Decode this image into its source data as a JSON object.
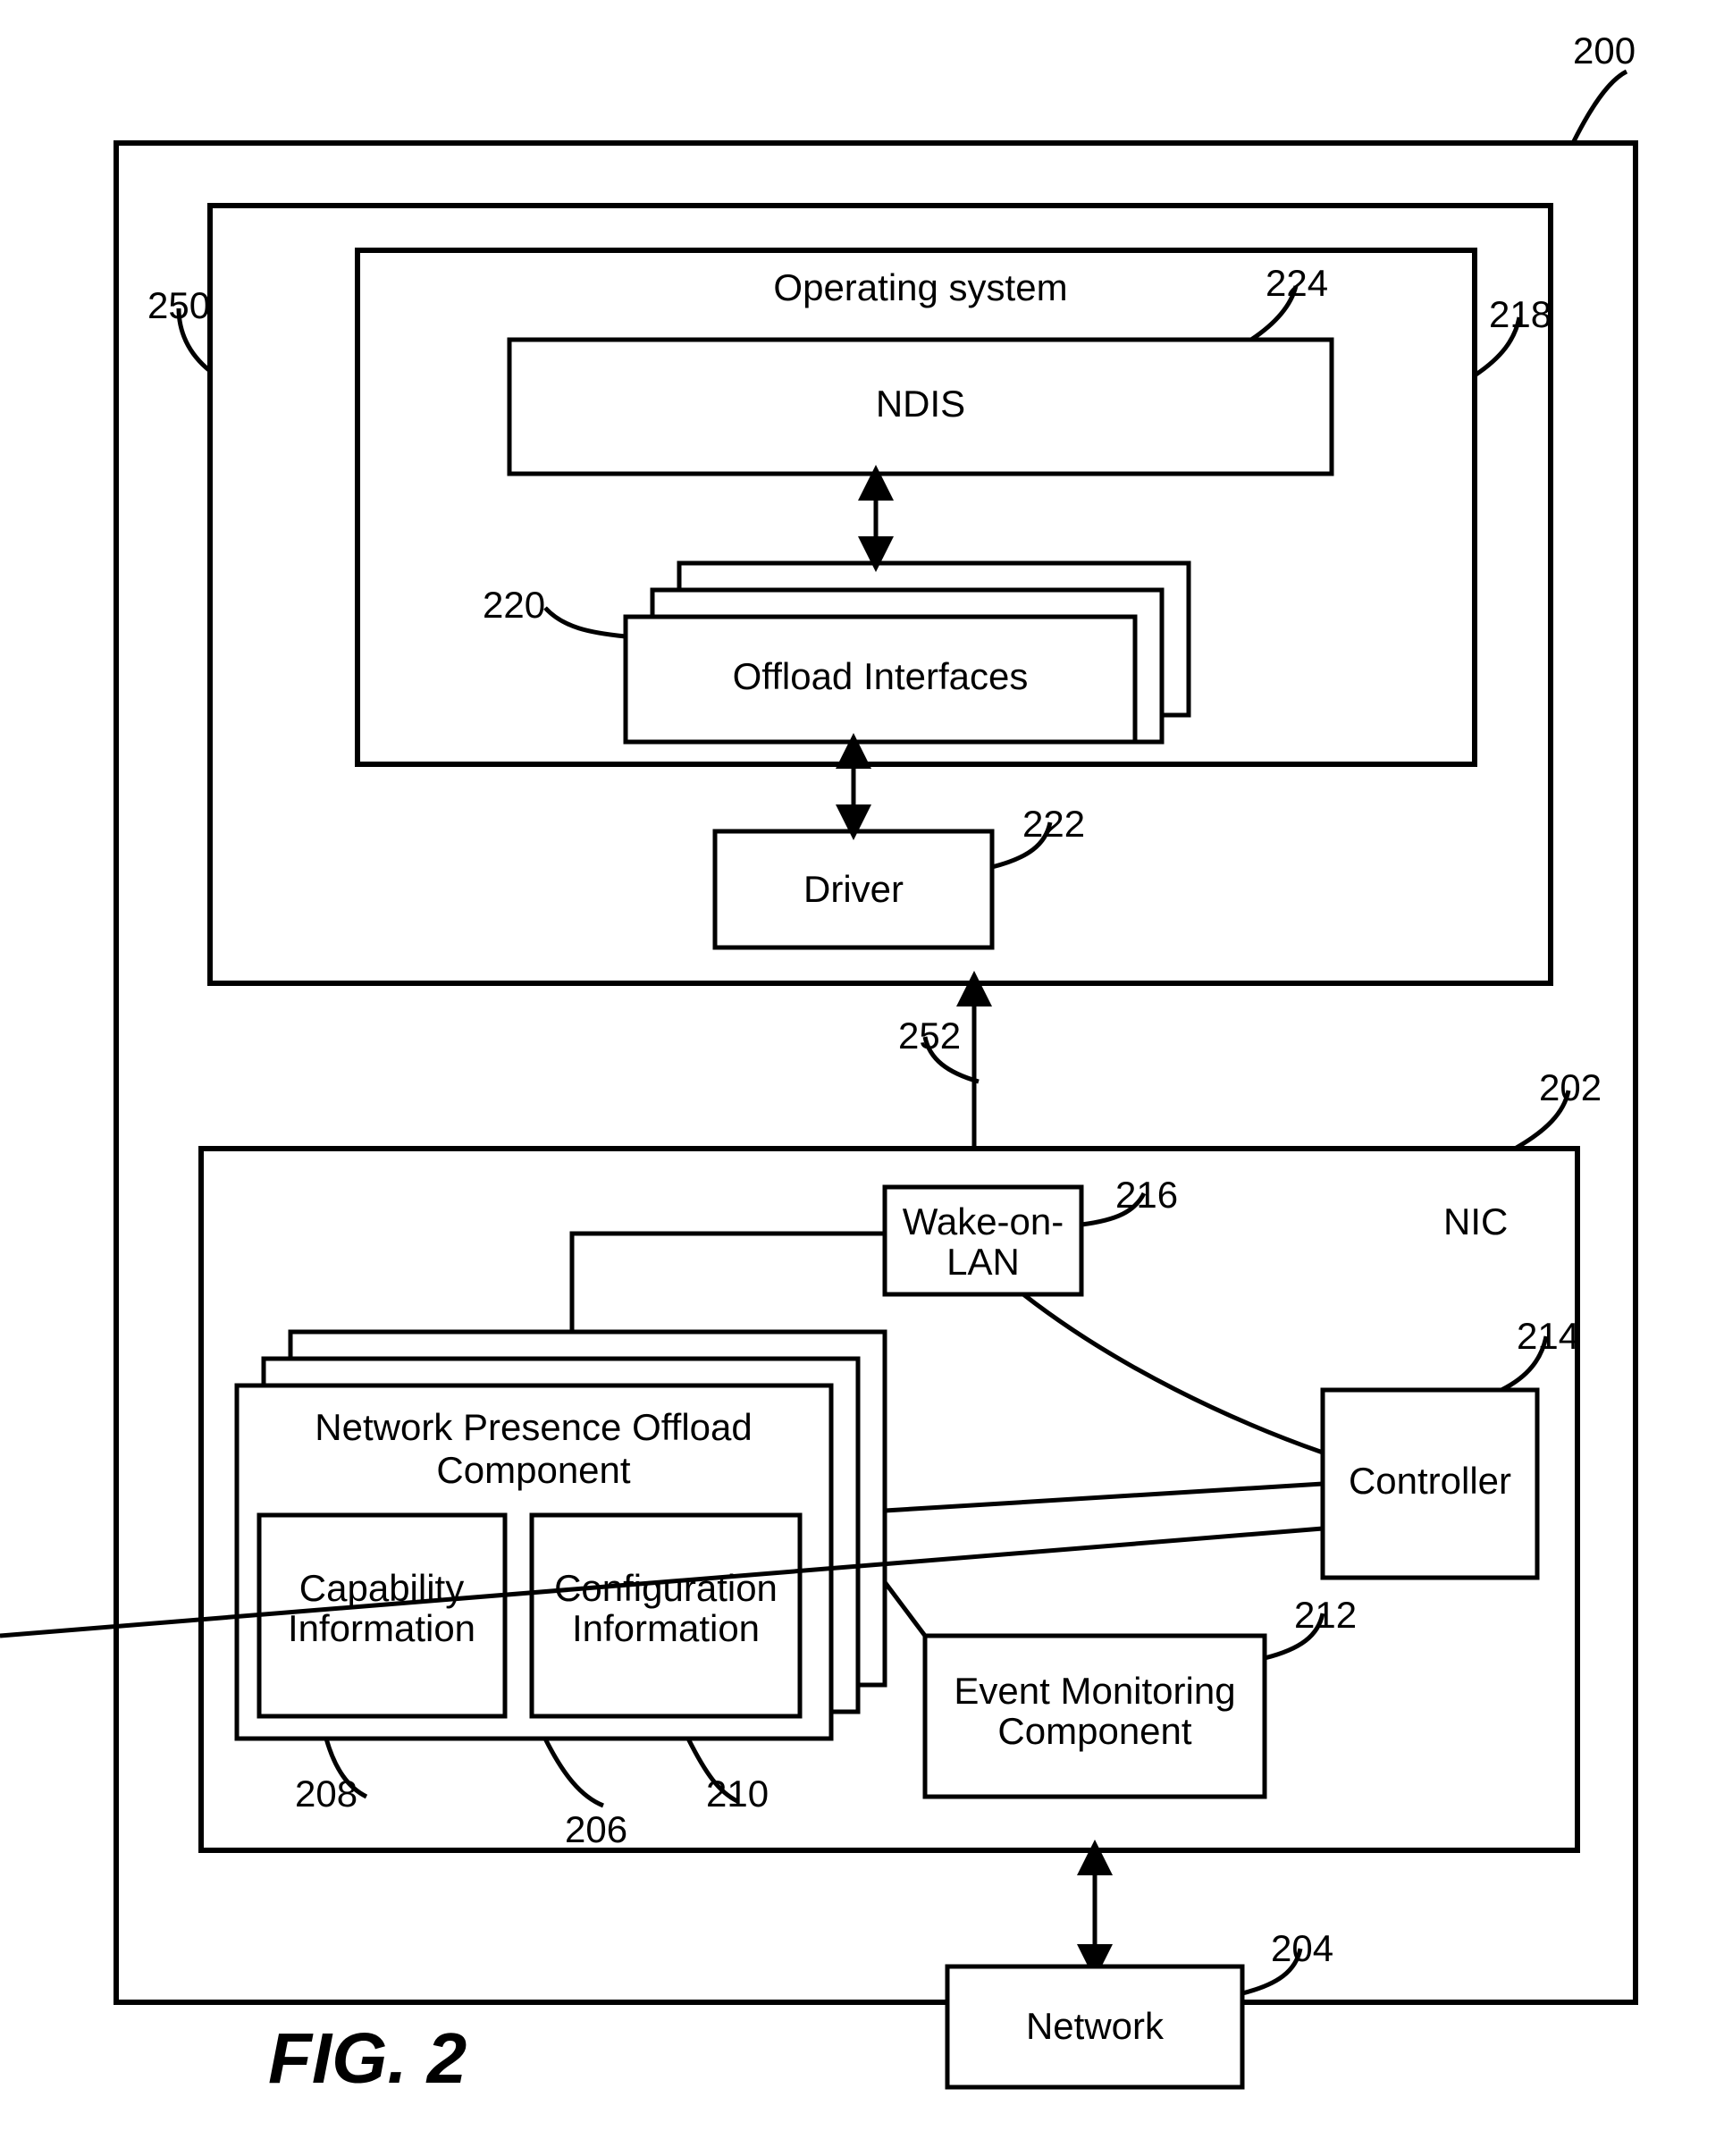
{
  "figure_label": "FIG. 2",
  "refs": {
    "r200": "200",
    "r250": "250",
    "r218": "218",
    "r224": "224",
    "r220": "220",
    "r222": "222",
    "r252": "252",
    "r202": "202",
    "r216": "216",
    "r214": "214",
    "r212": "212",
    "r206": "206",
    "r208": "208",
    "r210": "210",
    "r204": "204"
  },
  "labels": {
    "os": "Operating system",
    "ndis": "NDIS",
    "offload_interfaces": "Offload Interfaces",
    "driver": "Driver",
    "nic": "NIC",
    "wol_l1": "Wake-on-",
    "wol_l2": "LAN",
    "controller": "Controller",
    "npoc_l1": "Network Presence Offload",
    "npoc_l2": "Component",
    "cap_l1": "Capability",
    "cap_l2": "Information",
    "cfg_l1": "Configuration",
    "cfg_l2": "Information",
    "evt_l1": "Event Monitoring",
    "evt_l2": "Component",
    "network": "Network"
  }
}
